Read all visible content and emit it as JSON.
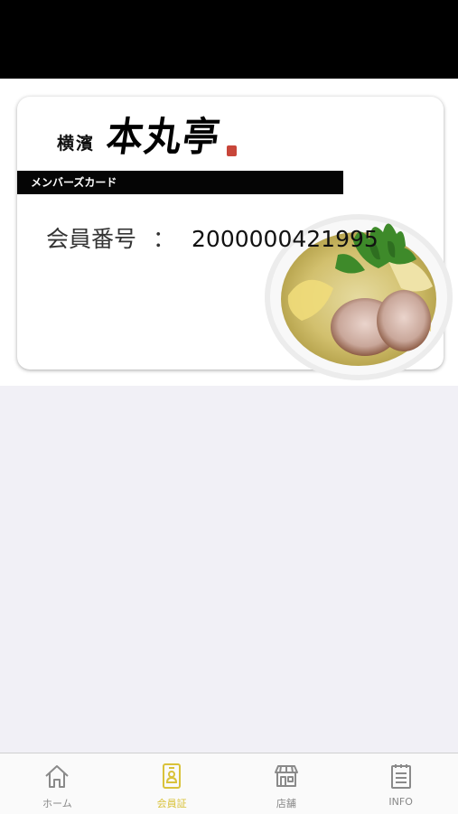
{
  "card": {
    "brand_small": "横濱",
    "brand_main": "本丸亭",
    "banner": "メンバーズカード",
    "member_label": "会員番号",
    "separator": "：",
    "member_number": "2000000421995"
  },
  "tabs": [
    {
      "label": "ホーム",
      "icon": "home-icon",
      "active": false
    },
    {
      "label": "会員証",
      "icon": "member-card-icon",
      "active": true
    },
    {
      "label": "店舗",
      "icon": "store-icon",
      "active": false
    },
    {
      "label": "INFO",
      "icon": "info-list-icon",
      "active": false
    }
  ],
  "colors": {
    "accent": "#d9c23a",
    "inactive": "#888888",
    "banner": "#050505",
    "background": "#f1f0f6"
  }
}
